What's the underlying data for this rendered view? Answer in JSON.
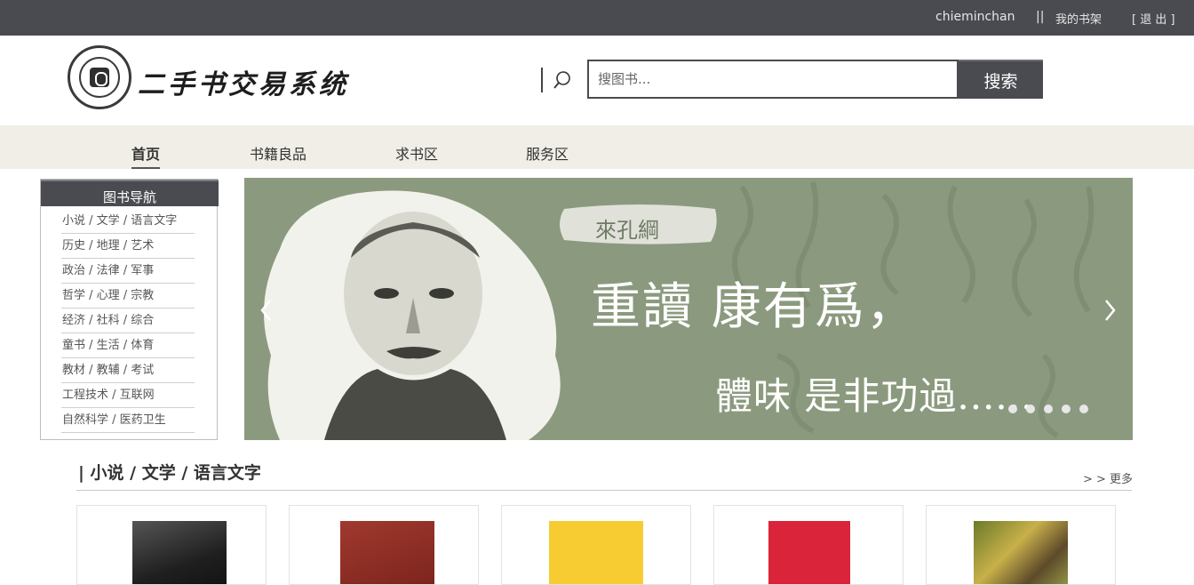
{
  "topbar": {
    "username": "chieminchan",
    "separator": "||",
    "bookshelf_label": "我的书架",
    "logout_label": "[ 退 出 ]"
  },
  "header": {
    "site_title": "二手书交易系统",
    "search": {
      "placeholder": "搜图书...",
      "button_label": "搜索"
    }
  },
  "nav": {
    "items": [
      {
        "label": "首页",
        "active": true
      },
      {
        "label": "书籍良品",
        "active": false
      },
      {
        "label": "求书区",
        "active": false
      },
      {
        "label": "服务区",
        "active": false
      }
    ]
  },
  "sidebar": {
    "title": "图书导航",
    "links": [
      "小说 / 文学 / 语言文字",
      "历史 / 地理 / 艺术",
      "政治 / 法律 / 军事",
      "哲学 / 心理 / 宗教",
      "经济 / 社科 / 综合",
      "童书 / 生活 / 体育",
      "教材 / 教辅 / 考试",
      "工程技术 / 互联网",
      "自然科学 / 医药卫生"
    ]
  },
  "banner": {
    "author_tag": "來孔綱",
    "headline": "重讀 康有爲，",
    "subline": "體味 是非功過......",
    "slide_count": 5,
    "accent_color": "#8b9a7e"
  },
  "section": {
    "title": "| 小说 / 文学 / 语言文字",
    "more_label": "> > 更多",
    "books": [
      {
        "cover_color": "#2a2a2a"
      },
      {
        "cover_color": "#8a2a22"
      },
      {
        "cover_color": "#f4c431"
      },
      {
        "cover_color": "#d62a35"
      },
      {
        "cover_color": "#5a6a2a"
      }
    ]
  }
}
